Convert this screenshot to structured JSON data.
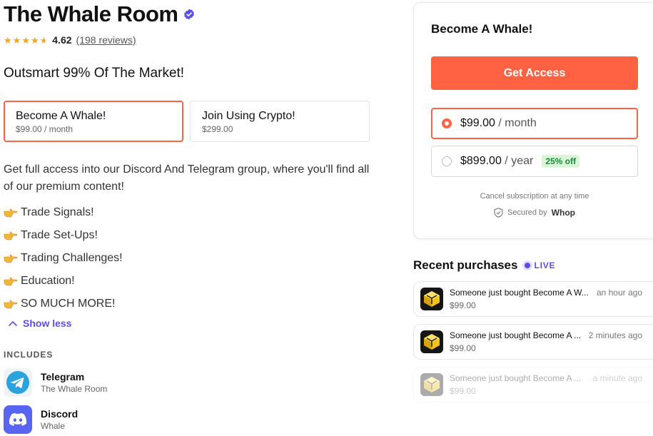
{
  "product": {
    "title": "The Whale Room",
    "rating": "4.62",
    "reviews_link": "(198 reviews)",
    "star_count": 4.62,
    "tagline": "Outsmart 99% Of The Market!"
  },
  "plans": [
    {
      "title": "Become A Whale!",
      "price": "$99.00 / month"
    },
    {
      "title": "Join Using Crypto!",
      "price": "$299.00"
    }
  ],
  "description": "Get full access into our Discord And Telegram group, where you'll find all of our premium content!",
  "bullets": [
    "Trade Signals!",
    "Trade Set-Ups!",
    "Trading Challenges!",
    "Education!",
    "SO MUCH MORE!"
  ],
  "show_less": "Show less",
  "includes": {
    "heading": "INCLUDES",
    "items": [
      {
        "name": "Telegram",
        "sub": "The Whale Room",
        "icon": "telegram-icon"
      },
      {
        "name": "Discord",
        "sub": "Whale",
        "icon": "discord-icon"
      }
    ]
  },
  "checkout": {
    "title": "Become A Whale!",
    "cta": "Get Access",
    "options": [
      {
        "price": "$99.00",
        "period": "/ month",
        "selected": true
      },
      {
        "price": "$899.00",
        "period": "/ year",
        "badge": "25% off",
        "selected": false
      }
    ],
    "cancel_note": "Cancel subscription at any time",
    "secured_by": "Secured by",
    "brand": "Whop"
  },
  "recent": {
    "heading": "Recent purchases",
    "live": "LIVE",
    "items": [
      {
        "text": "Someone just bought Become A W...",
        "time": "an hour ago",
        "amount": "$99.00"
      },
      {
        "text": "Someone just bought Become A ...",
        "time": "2 minutes ago",
        "amount": "$99.00"
      },
      {
        "text": "Someone just bought Become A ...",
        "time": "a minute ago",
        "amount": "$99.00"
      }
    ]
  },
  "colors": {
    "accent": "#ff6243",
    "link": "#5b4ee6",
    "star": "#f5a524",
    "badge_bg": "#d9f6d9"
  }
}
